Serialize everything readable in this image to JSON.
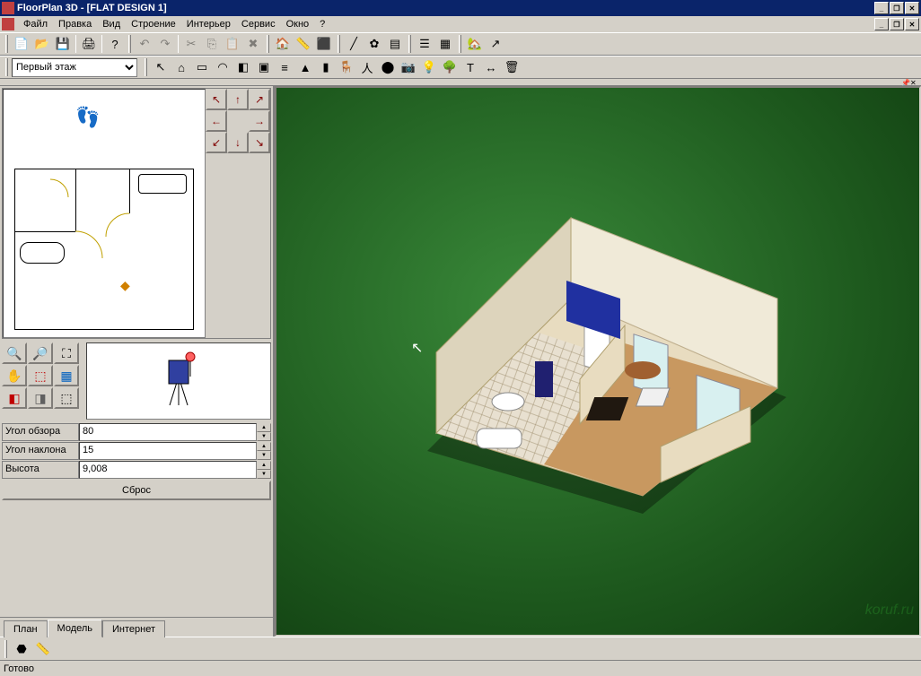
{
  "window": {
    "title": "FloorPlan 3D - [FLAT DESIGN 1]"
  },
  "menu": {
    "file": "Файл",
    "edit": "Правка",
    "view": "Вид",
    "building": "Строение",
    "interior": "Интерьер",
    "service": "Сервис",
    "window": "Окно",
    "help": "?"
  },
  "floor_selector": {
    "selected": "Первый этаж"
  },
  "camera_params": {
    "fov_label": "Угол обзора",
    "fov_value": "80",
    "tilt_label": "Угол наклона",
    "tilt_value": "15",
    "height_label": "Высота",
    "height_value": "9,008",
    "reset_label": "Сброс"
  },
  "tabs": {
    "plan": "План",
    "model": "Модель",
    "internet": "Интернет",
    "active": "model"
  },
  "statusbar": {
    "text": "Готово"
  },
  "watermark": "koruf.ru",
  "icons": {
    "new": "📄",
    "open": "📂",
    "save": "💾",
    "print": "🖨",
    "help": "?",
    "undo": "↶",
    "redo": "↷",
    "cut": "✂",
    "copy": "⎘",
    "paste": "📋",
    "delete": "✖",
    "render3d": "🏠",
    "ruler": "📏",
    "grid": "▦",
    "pointer": "↖",
    "wall": "▭",
    "arc": "◠",
    "door": "◧",
    "window": "▣",
    "stairs": "≡",
    "roof": "▲",
    "furniture": "🪑",
    "camera": "📷",
    "light": "💡",
    "tree": "🌳",
    "text": "T",
    "zoom_in": "🔍",
    "zoom_out": "🔎",
    "zoom_ext": "⛶",
    "pan": "✋",
    "select_box": "⬚",
    "select_all": "▦",
    "cube_red": "◧",
    "cube_gray": "◨",
    "cube_wire": "⬚"
  },
  "nav_arrows": {
    "nw": "↖",
    "n": "↑",
    "ne": "↗",
    "w": "←",
    "e": "→",
    "sw": "↙",
    "s": "↓",
    "se": "↘"
  }
}
